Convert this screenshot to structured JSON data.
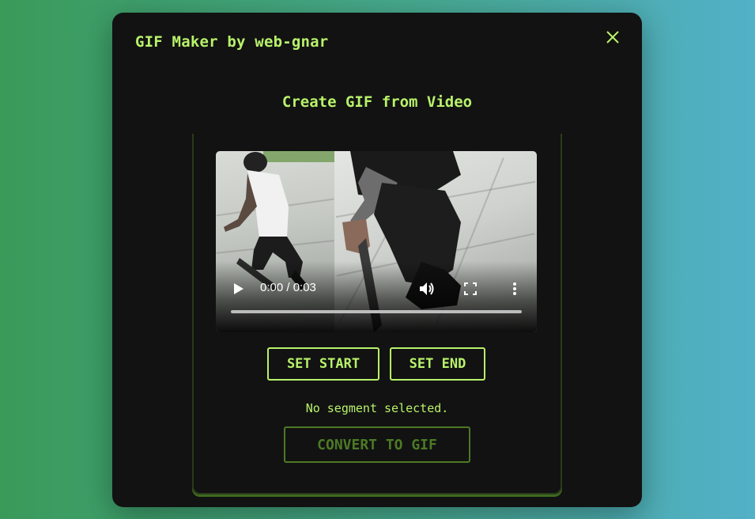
{
  "modal": {
    "title": "GIF Maker by web-gnar",
    "close_icon": "close-icon",
    "subtitle": "Create GIF from Video"
  },
  "video": {
    "time_display": "0:00 / 0:03",
    "progress_fraction": 0,
    "icons": [
      "play-icon",
      "volume-icon",
      "fullscreen-icon",
      "more-options-icon"
    ]
  },
  "controls": {
    "set_start_label": "SET START",
    "set_end_label": "SET END",
    "status_text": "No segment selected.",
    "convert_label": "CONVERT TO GIF",
    "convert_disabled": true
  },
  "colors": {
    "accent": "#b8f26a",
    "disabled": "#4c7a24",
    "modal_bg": "#121212"
  }
}
